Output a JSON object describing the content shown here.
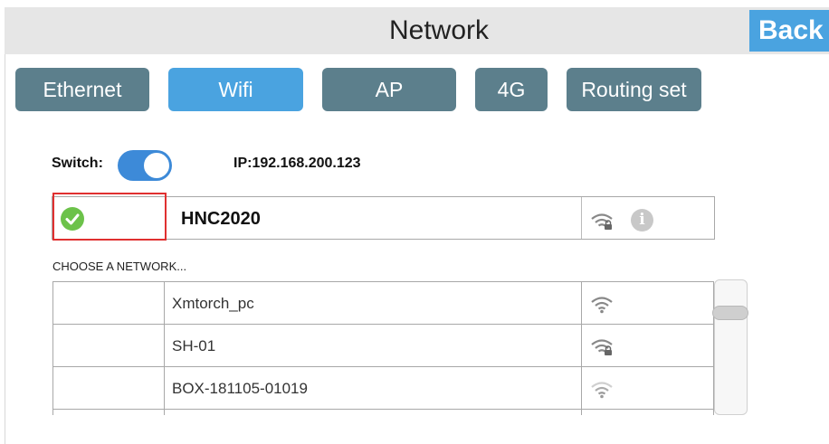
{
  "header": {
    "title": "Network",
    "back_label": "Back"
  },
  "tabs": [
    {
      "label": "Ethernet",
      "active": false
    },
    {
      "label": "Wifi",
      "active": true
    },
    {
      "label": "AP",
      "active": false
    },
    {
      "label": "4G",
      "active": false
    },
    {
      "label": "Routing set",
      "active": false
    }
  ],
  "wifi": {
    "switch_label": "Switch:",
    "switch_on": true,
    "ip_text": "IP:192.168.200.123",
    "current": {
      "ssid": "HNC2020",
      "status_icon": "check-circle-icon",
      "signal_icon": "wifi-locked-icon",
      "info_icon": "info-icon",
      "info_glyph": "i"
    },
    "choose_label": "CHOOSE A NETWORK...",
    "networks": [
      {
        "name": "Xmtorch_pc",
        "signal_icon": "wifi-icon"
      },
      {
        "name": "SH-01",
        "signal_icon": "wifi-locked-icon"
      },
      {
        "name": "BOX-181105-01019",
        "signal_icon": "wifi-weak-icon"
      }
    ]
  },
  "colors": {
    "accent": "#4aa3e0",
    "tab_inactive": "#5c7f8c",
    "toggle_on": "#3d8ad8",
    "check_green": "#6cc24a",
    "highlight_red": "#e03030",
    "header_bg": "#e6e6e6"
  }
}
